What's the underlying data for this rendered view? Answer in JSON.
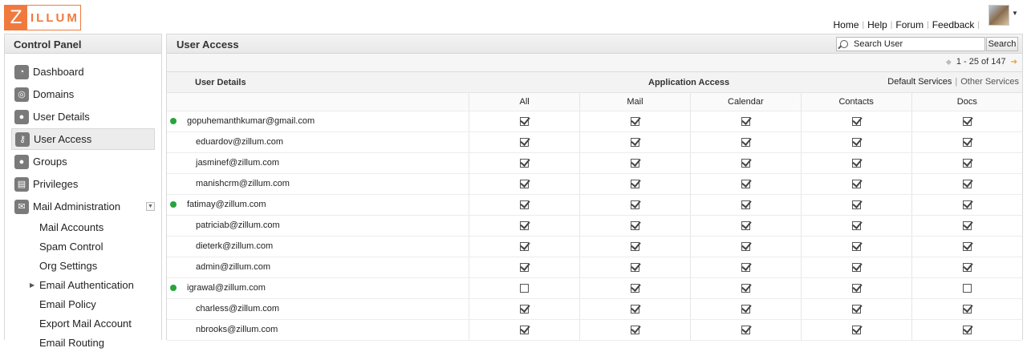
{
  "logo": {
    "first": "Z",
    "rest": "ILLUM"
  },
  "toplinks": [
    "Home",
    "Help",
    "Forum",
    "Feedback"
  ],
  "sidebar": {
    "title": "Control Panel",
    "items": [
      {
        "label": "Dashboard",
        "icon": "dashboard-icon",
        "glyph": "◔"
      },
      {
        "label": "Domains",
        "icon": "domains-icon",
        "glyph": "◎"
      },
      {
        "label": "User Details",
        "icon": "user-icon",
        "glyph": "●"
      },
      {
        "label": "User Access",
        "icon": "user-access-icon",
        "glyph": "⚷",
        "active": true
      },
      {
        "label": "Groups",
        "icon": "groups-icon",
        "glyph": "●"
      },
      {
        "label": "Privileges",
        "icon": "privileges-icon",
        "glyph": "▤"
      },
      {
        "label": "Mail Administration",
        "icon": "mail-icon",
        "glyph": "✉",
        "expandable": true
      }
    ],
    "subitems": [
      {
        "label": "Mail Accounts"
      },
      {
        "label": "Spam Control"
      },
      {
        "label": "Org Settings"
      },
      {
        "label": "Email Authentication",
        "arrow": true
      },
      {
        "label": "Email Policy"
      },
      {
        "label": "Export Mail Account"
      },
      {
        "label": "Email Routing"
      }
    ]
  },
  "main": {
    "title": "User Access",
    "search_placeholder": "Search User",
    "search_button": "Search",
    "pager": "1 - 25 of 147",
    "user_details_header": "User Details",
    "app_access_header": "Application Access",
    "services_default": "Default Services",
    "services_other": "Other Services",
    "columns": [
      "All",
      "Mail",
      "Calendar",
      "Contacts",
      "Docs"
    ],
    "rows": [
      {
        "email": "gopuhemanthkumar@gmail.com",
        "online": true,
        "access": [
          true,
          true,
          true,
          true,
          true
        ]
      },
      {
        "email": "eduardov@zillum.com",
        "online": false,
        "access": [
          true,
          true,
          true,
          true,
          true
        ]
      },
      {
        "email": "jasminef@zillum.com",
        "online": false,
        "access": [
          true,
          true,
          true,
          true,
          true
        ]
      },
      {
        "email": "manishcrm@zillum.com",
        "online": false,
        "access": [
          true,
          true,
          true,
          true,
          true
        ]
      },
      {
        "email": "fatimay@zillum.com",
        "online": true,
        "access": [
          true,
          true,
          true,
          true,
          true
        ]
      },
      {
        "email": "patriciab@zillum.com",
        "online": false,
        "access": [
          true,
          true,
          true,
          true,
          true
        ]
      },
      {
        "email": "dieterk@zillum.com",
        "online": false,
        "access": [
          true,
          true,
          true,
          true,
          true
        ]
      },
      {
        "email": "admin@zillum.com",
        "online": false,
        "access": [
          true,
          true,
          true,
          true,
          true
        ]
      },
      {
        "email": "igrawal@zillum.com",
        "online": true,
        "access": [
          false,
          true,
          true,
          true,
          false
        ]
      },
      {
        "email": "charless@zillum.com",
        "online": false,
        "access": [
          true,
          true,
          true,
          true,
          true
        ]
      },
      {
        "email": "nbrooks@zillum.com",
        "online": false,
        "access": [
          true,
          true,
          true,
          true,
          true
        ]
      }
    ]
  }
}
